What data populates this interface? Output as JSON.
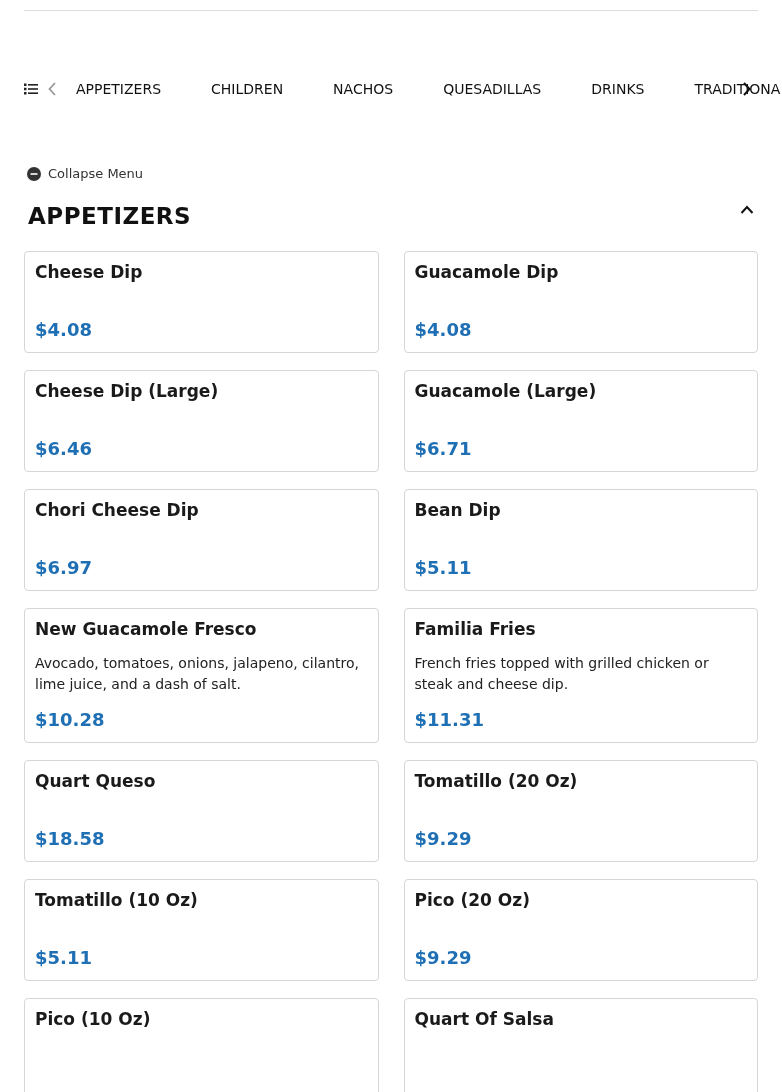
{
  "category_nav": [
    "APPETIZERS",
    "CHILDREN",
    "NACHOS",
    "QUESADILLAS",
    "DRINKS",
    "TRADITIONA"
  ],
  "collapse_label": "Collapse Menu",
  "section": {
    "title": "APPETIZERS",
    "expanded": true,
    "items": [
      {
        "name": "Cheese Dip",
        "price": "$4.08"
      },
      {
        "name": "Guacamole Dip",
        "price": "$4.08"
      },
      {
        "name": "Cheese Dip (Large)",
        "price": "$6.46"
      },
      {
        "name": "Guacamole (Large)",
        "price": "$6.71"
      },
      {
        "name": "Chori Cheese Dip",
        "price": "$6.97"
      },
      {
        "name": "Bean Dip",
        "price": "$5.11"
      },
      {
        "name": "New Guacamole Fresco",
        "description": "Avocado, tomatoes, onions, jalapeno, cilantro, lime juice, and a dash of salt.",
        "price": "$10.28"
      },
      {
        "name": "Familia Fries",
        "description": "French fries topped with grilled chicken or steak and cheese dip.",
        "price": "$11.31"
      },
      {
        "name": "Quart Queso",
        "price": "$18.58"
      },
      {
        "name": "Tomatillo (20 Oz)",
        "price": "$9.29"
      },
      {
        "name": "Tomatillo (10 Oz)",
        "price": "$5.11"
      },
      {
        "name": "Pico (20 Oz)",
        "price": "$9.29"
      },
      {
        "name": "Pico (10 Oz)"
      },
      {
        "name": "Quart Of Salsa"
      }
    ]
  }
}
